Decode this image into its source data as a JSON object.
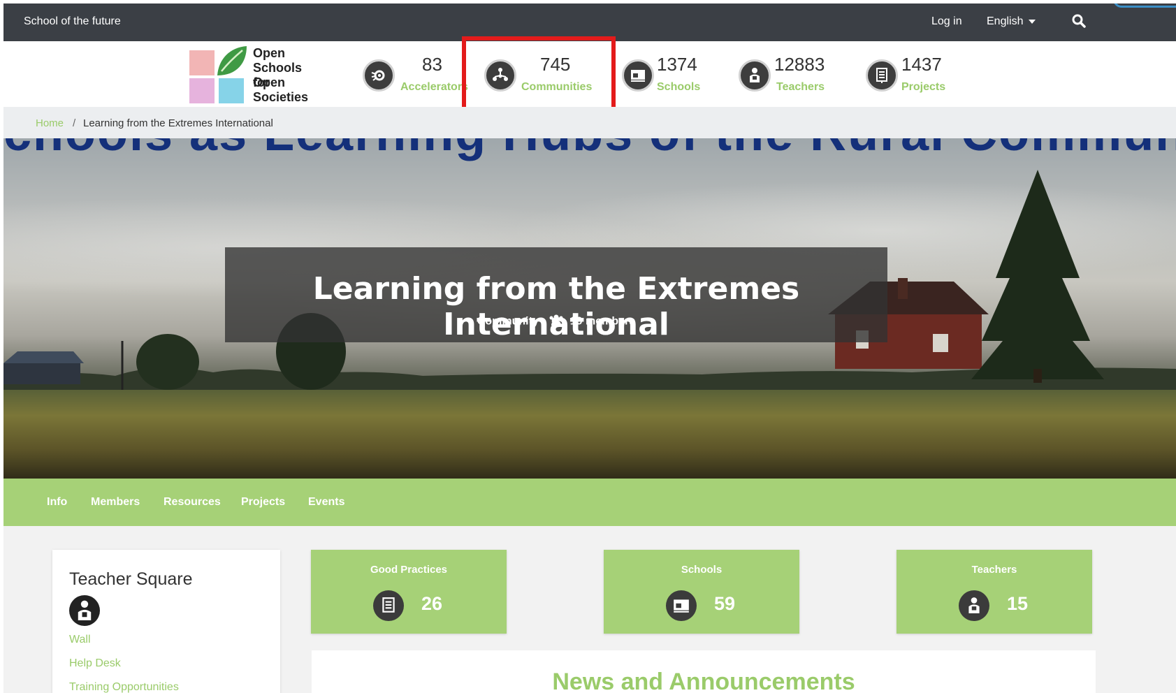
{
  "topbar": {
    "brand": "School of the future",
    "login": "Log in",
    "language": "English"
  },
  "logo": {
    "line1": "Open",
    "line2": "Schools for",
    "line3": "Open",
    "line4": "Societies",
    "colors": [
      "#f0a6a8",
      "#3f9a44",
      "#e6a8d8",
      "#7fd0e6"
    ]
  },
  "stats": [
    {
      "value": "83",
      "label": "Accelerators",
      "icon": "accelerators-gear-icon"
    },
    {
      "value": "745",
      "label": "Communities",
      "icon": "communities-network-icon"
    },
    {
      "value": "1374",
      "label": "Schools",
      "icon": "schools-board-icon"
    },
    {
      "value": "12883",
      "label": "Teachers",
      "icon": "teacher-person-icon"
    },
    {
      "value": "1437",
      "label": "Projects",
      "icon": "projects-document-icon"
    }
  ],
  "breadcrumb": {
    "home": "Home",
    "separator": "/",
    "current": "Learning from the Extremes International"
  },
  "hero": {
    "background_text": "chools as Learning Hubs of the Rural Community",
    "title": "Learning from the Extremes International",
    "type": "Community",
    "members": "19 members"
  },
  "tabs": [
    "Info",
    "Members",
    "Resources",
    "Projects",
    "Events"
  ],
  "sidebar": {
    "heading": "Teacher Square",
    "links": [
      "Wall",
      "Help Desk",
      "Training Opportunities"
    ]
  },
  "cards": [
    {
      "title": "Good Practices",
      "value": "26",
      "icon": "projects-document-icon"
    },
    {
      "title": "Schools",
      "value": "59",
      "icon": "schools-board-icon"
    },
    {
      "title": "Teachers",
      "value": "15",
      "icon": "teacher-person-icon"
    }
  ],
  "news": {
    "title": "News and Announcements"
  },
  "colors": {
    "accent_green": "#a6d177",
    "label_green": "#9acb6a",
    "topbar": "#3b3f45",
    "highlight_red": "#e31b1b"
  }
}
